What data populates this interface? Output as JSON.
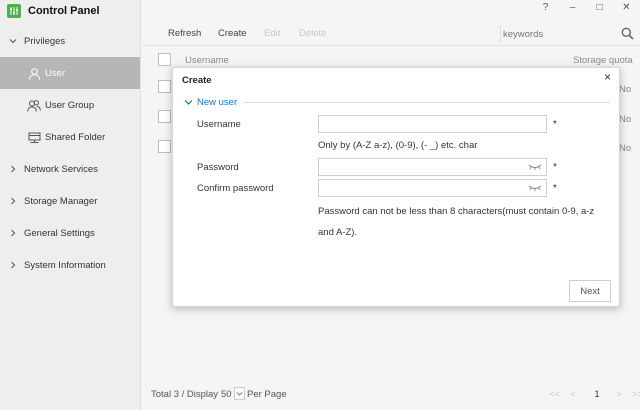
{
  "app": {
    "title": "Control Panel",
    "logo_icon": "control-panel-logo-icon",
    "accent_color": "#4caf50"
  },
  "window_controls": {
    "help": "?",
    "minimize": "–",
    "maximize": "□",
    "close": "✕"
  },
  "sidebar": {
    "groups": [
      {
        "label": "Privileges",
        "expanded": true
      },
      {
        "label": "Network Services",
        "expanded": false
      },
      {
        "label": "Storage Manager",
        "expanded": false
      },
      {
        "label": "General Settings",
        "expanded": false
      },
      {
        "label": "System Information",
        "expanded": false
      }
    ],
    "sub_items": [
      {
        "label": "User",
        "icon": "user-icon",
        "active": true
      },
      {
        "label": "User Group",
        "icon": "user-group-icon",
        "active": false
      },
      {
        "label": "Shared Folder",
        "icon": "shared-folder-icon",
        "active": false
      }
    ]
  },
  "toolbar": {
    "refresh": "Refresh",
    "create": "Create",
    "edit": "Edit",
    "delete": "Delete",
    "search_placeholder": "keywords"
  },
  "table": {
    "headers": {
      "username": "Username",
      "storage_quota": "Storage quota"
    },
    "rows": [
      {
        "storage_quota": "No"
      },
      {
        "storage_quota": "No"
      },
      {
        "storage_quota": "No"
      }
    ]
  },
  "footer": {
    "total": "Total 3 / Display",
    "per_page_value": "50",
    "per_page_label": "Per Page",
    "pager": {
      "first": "<<",
      "prev": "<",
      "current": "1",
      "next": ">",
      "last": ">>"
    }
  },
  "modal": {
    "title": "Create",
    "close": "×",
    "section_title": "New user",
    "username_label": "Username",
    "username_value": "",
    "username_hint": "Only by (A-Z a-z), (0-9), (- _) etc. char",
    "password_label": "Password",
    "password_value": "",
    "confirm_label": "Confirm password",
    "confirm_value": "",
    "required_mark": "*",
    "password_hint": "Password can not be less than 8 characters(must contain 0-9, a-z and A-Z).",
    "next_button": "Next"
  }
}
